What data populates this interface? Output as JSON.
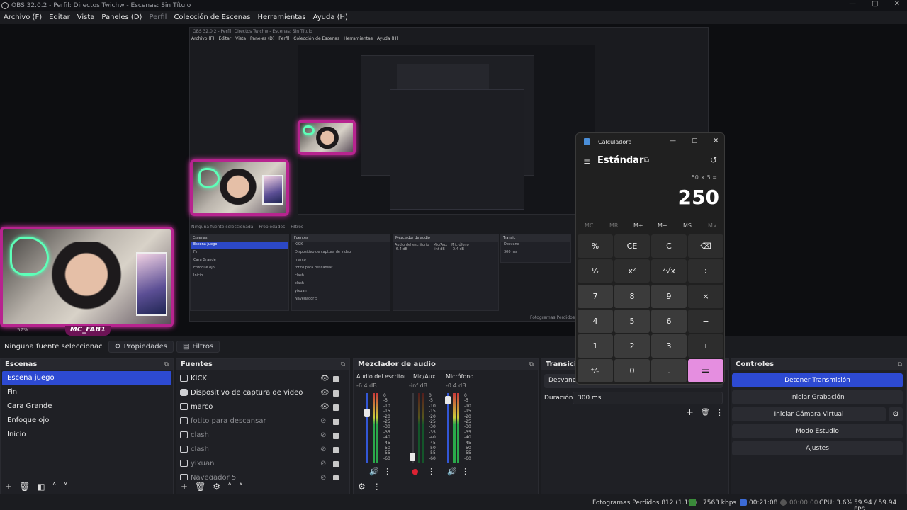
{
  "window": {
    "title": "OBS 32.0.2 - Perfil: Directos Twichw - Escenas: Sin Título",
    "min": "—",
    "max": "▢",
    "close": "✕"
  },
  "menu": [
    "Archivo (F)",
    "Editar",
    "Vista",
    "Paneles (D)",
    "Perfil",
    "Colección de Escenas",
    "Herramientas",
    "Ayuda (H)"
  ],
  "nested_obs": {
    "title": "OBS 32.0.2 - Perfil: Directos Twichw - Escenas: Sin Título",
    "menu": [
      "Archivo (F)",
      "Editar",
      "Vista",
      "Paneles (D)",
      "Perfil",
      "Colección de Escenas",
      "Herramientas",
      "Ayuda (H)"
    ],
    "no_source": "Ninguna fuente seleccionada",
    "props": "Propiedades",
    "filters": "Filtros",
    "scenes_head": "Escenas",
    "sources_head": "Fuentes",
    "mixer_head": "Mezclador de audio",
    "trans_head": "Transic",
    "scenes": [
      "Escena juego",
      "Fin",
      "Cara Grande",
      "Enfoque ojo",
      "Inicio"
    ],
    "sources": [
      "KICK",
      "Dispositivo de captura de video",
      "marco",
      "fotito para descansar",
      "clash",
      "clash",
      "yixuan",
      "Navegador 5"
    ],
    "mixer_channels": [
      "Audio del escritorio",
      "Mic/Aux",
      "Micrófono"
    ],
    "mixer_levels": [
      "-6.4 dB",
      "-inf dB",
      "-0.4 dB"
    ],
    "trans_button": "Desvane",
    "duration": "300 ms",
    "dropped": "Fotogramas Perdidos 812 (1.1%)"
  },
  "webcam_tag": "MC_FAB1",
  "zoom": "57%",
  "source_toolbar": {
    "no_source": "Ninguna fuente seleccionac",
    "properties": "Propiedades",
    "filters": "Filtros"
  },
  "scenes": {
    "title": "Escenas",
    "items": [
      "Escena juego",
      "Fin",
      "Cara Grande",
      "Enfoque ojo",
      "Inicio"
    ],
    "selected": 0
  },
  "sources": {
    "title": "Fuentes",
    "items": [
      {
        "name": "KICK",
        "visible": true
      },
      {
        "name": "Dispositivo de captura de video",
        "visible": true
      },
      {
        "name": "marco",
        "visible": true
      },
      {
        "name": "fotito para descansar",
        "visible": false
      },
      {
        "name": "clash",
        "visible": false
      },
      {
        "name": "clash",
        "visible": false
      },
      {
        "name": "yixuan",
        "visible": false
      },
      {
        "name": "Navegador 5",
        "visible": false
      }
    ]
  },
  "mixer": {
    "title": "Mezclador de audio",
    "channels": [
      {
        "name": "Audio del escritorio",
        "level": "-6.4 dB"
      },
      {
        "name": "Mic/Aux",
        "level": "-inf dB"
      },
      {
        "name": "Micrófono",
        "level": "-0.4 dB"
      }
    ],
    "ticks": [
      "0",
      "-5",
      "-10",
      "-15",
      "-20",
      "-25",
      "-30",
      "-35",
      "-40",
      "-45",
      "-50",
      "-55",
      "-60"
    ]
  },
  "transitions": {
    "title": "Transicion",
    "selected": "Desvaneci",
    "duration_label": "Duración",
    "duration_value": "300 ms"
  },
  "controls": {
    "title": "Controles",
    "stop_stream": "Detener Transmisión",
    "start_recording": "Iniciar Grabación",
    "start_virtual_cam": "Iniciar Cámara Virtual",
    "studio_mode": "Modo Estudio",
    "settings": "Ajustes"
  },
  "calculator": {
    "title": "Calculadora",
    "mode": "Estándar",
    "expression": "50 × 5 =",
    "display": "250",
    "memory": [
      "MC",
      "MR",
      "M+",
      "M−",
      "MS",
      "M∨"
    ],
    "keys": [
      [
        "%",
        "CE",
        "C",
        "⌫"
      ],
      [
        "¹⁄ₓ",
        "x²",
        "²√x",
        "÷"
      ],
      [
        "7",
        "8",
        "9",
        "×"
      ],
      [
        "4",
        "5",
        "6",
        "−"
      ],
      [
        "1",
        "2",
        "3",
        "+"
      ],
      [
        "⁺⁄₋",
        "0",
        ".",
        "="
      ]
    ]
  },
  "status": {
    "dropped": "Fotogramas Perdidos 812 (1.1%)",
    "bitrate": "7563 kbps",
    "stream_time": "00:21:08",
    "rec_time": "00:00:00",
    "cpu": "CPU: 3.6%",
    "fps": "59.94 / 59.94 FPS"
  },
  "colors": {
    "accent": "#2d4ad2",
    "neon": "#5dffb8",
    "frame": "#b7248f",
    "calc_equals": "#e58ee0"
  }
}
